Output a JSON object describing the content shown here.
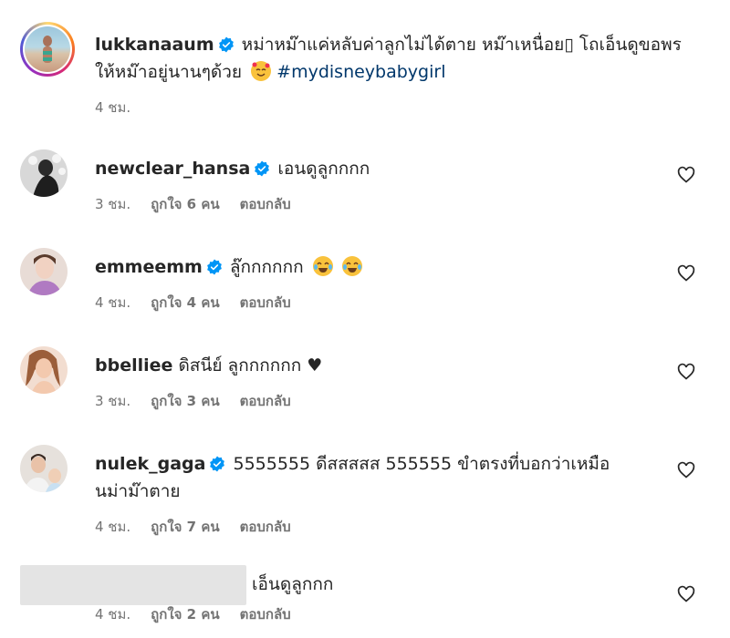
{
  "post": {
    "username": "lukkanaaum",
    "caption": "หม่าหม๊าแค่หลับค่าลูกไม่ได้ตาย หม๊าเหนื่อย▯ โถเอ็นดูขอพรให้หม๊าอยู่นานๆด้วย",
    "hashtag": "#mydisneybabygirl",
    "time": "4 ชม."
  },
  "comments": [
    {
      "username": "newclear_hansa",
      "text": "เอนดูลูกกกก",
      "time": "3 ชม.",
      "likes": "ถูกใจ 6 คน",
      "reply": "ตอบกลับ"
    },
    {
      "username": "emmeemm",
      "text": "ลู๊กกกกกก",
      "time": "4 ชม.",
      "likes": "ถูกใจ 4 คน",
      "reply": "ตอบกลับ"
    },
    {
      "username": "bbelliee",
      "text": "ดิสนีย์ ลูกกกกกก ♥",
      "time": "3 ชม.",
      "likes": "ถูกใจ 3 คน",
      "reply": "ตอบกลับ"
    },
    {
      "username": "nulek_gaga",
      "text": "5555555 ดีสสสสส 555555 ขำตรงที่บอกว่าเหมือนม่าม๊าตาย",
      "time": "4 ชม.",
      "likes": "ถูกใจ 7 คน",
      "reply": "ตอบกลับ"
    },
    {
      "username": "",
      "text": "เอ็นดูลูกกก",
      "time": "4 ชม.",
      "likes": "ถูกใจ 2 คน",
      "reply": "ตอบกลับ"
    }
  ],
  "colors": {
    "verified": "#0095f6",
    "hashtag": "#00376b",
    "meta": "#737373"
  },
  "icons": {
    "verified": "verified-badge-icon",
    "like": "heart-outline-icon",
    "emoji_post": "smiling-face-with-hearts-emoji",
    "emoji_laugh": "face-with-tears-of-joy-emoji"
  }
}
